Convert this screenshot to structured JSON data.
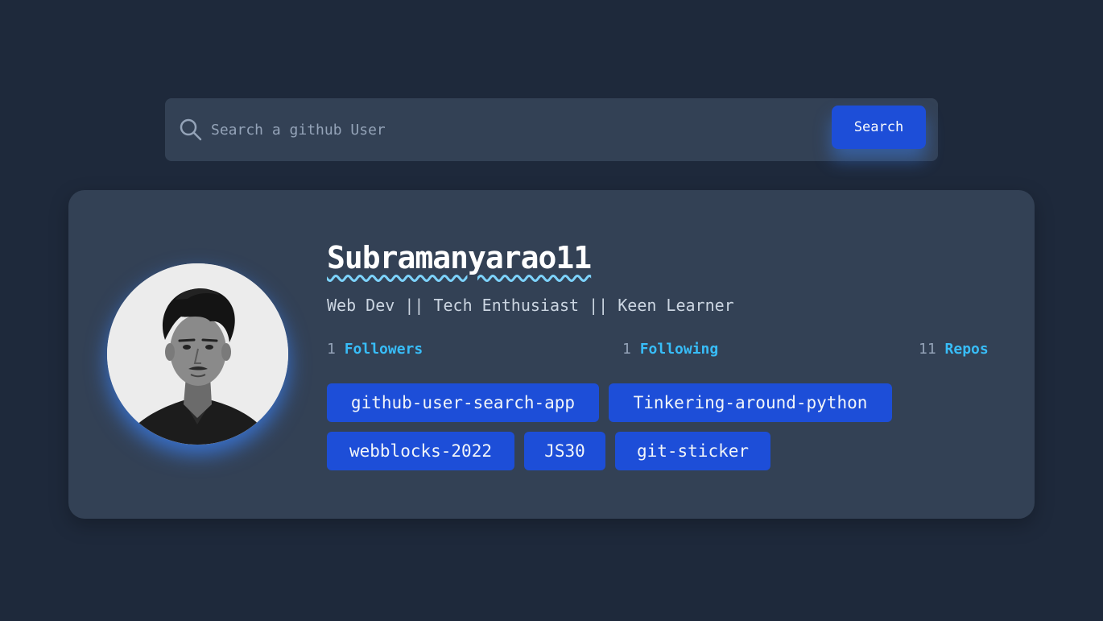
{
  "search": {
    "placeholder": "Search a github User",
    "button_label": "Search"
  },
  "profile": {
    "username": "Subramanyarao11",
    "bio": "Web Dev || Tech Enthusiast || Keen Learner",
    "stats": {
      "followers": {
        "count": "1",
        "label": "Followers"
      },
      "following": {
        "count": "1",
        "label": "Following"
      },
      "repos": {
        "count": "11",
        "label": "Repos"
      }
    },
    "repos": [
      "github-user-search-app",
      "Tinkering-around-python",
      "webblocks-2022",
      "JS30",
      "git-sticker"
    ]
  },
  "colors": {
    "background": "#1e293b",
    "card": "#334155",
    "accent": "#1d4ed8",
    "link": "#38bdf8",
    "underline": "#7dd3fc"
  }
}
